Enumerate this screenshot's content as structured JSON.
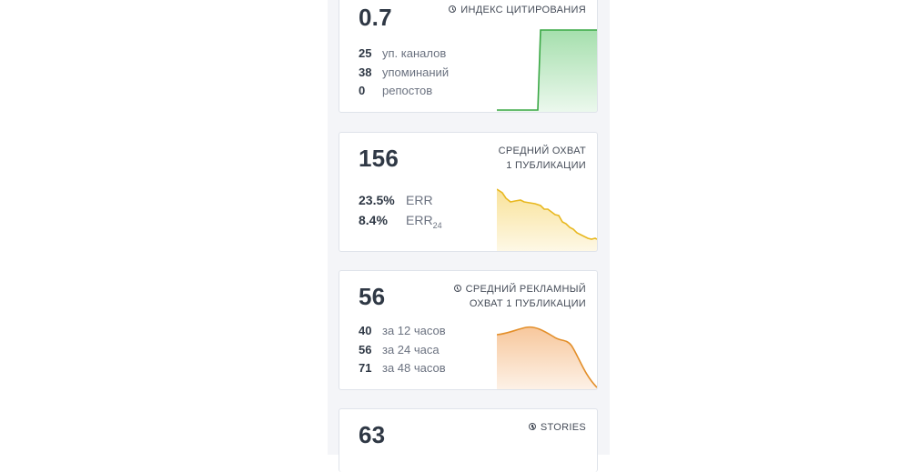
{
  "cards": [
    {
      "value": "0.7",
      "title": [
        "ИНДЕКС ЦИТИРОВАНИЯ"
      ],
      "has_info_icon": true,
      "stats": [
        {
          "num": "25",
          "label": "уп. каналов"
        },
        {
          "num": "38",
          "label": "упоминаний"
        },
        {
          "num": "0",
          "label": "репостов"
        }
      ],
      "sparkline_color": "#3aa845"
    },
    {
      "value": "156",
      "title": [
        "СРЕДНИЙ ОХВАТ",
        "1 ПУБЛИКАЦИИ"
      ],
      "has_info_icon": false,
      "stats": [
        {
          "num": "23.5%",
          "label": "ERR"
        },
        {
          "num": "8.4%",
          "label": "ERR",
          "label_sub": "24"
        }
      ],
      "sparkline_color": "#e8b820"
    },
    {
      "value": "56",
      "title": [
        "СРЕДНИЙ РЕКЛАМНЫЙ",
        "ОХВАТ 1 ПУБЛИКАЦИИ"
      ],
      "has_info_icon": true,
      "stats": [
        {
          "num": "40",
          "label": "за 12 часов"
        },
        {
          "num": "56",
          "label": "за 24 часа"
        },
        {
          "num": "71",
          "label": "за 48 часов"
        }
      ],
      "sparkline_color": "#e38f2a"
    },
    {
      "value": "63",
      "title": [
        "STORIES"
      ],
      "has_info_icon": true,
      "stats": []
    }
  ]
}
